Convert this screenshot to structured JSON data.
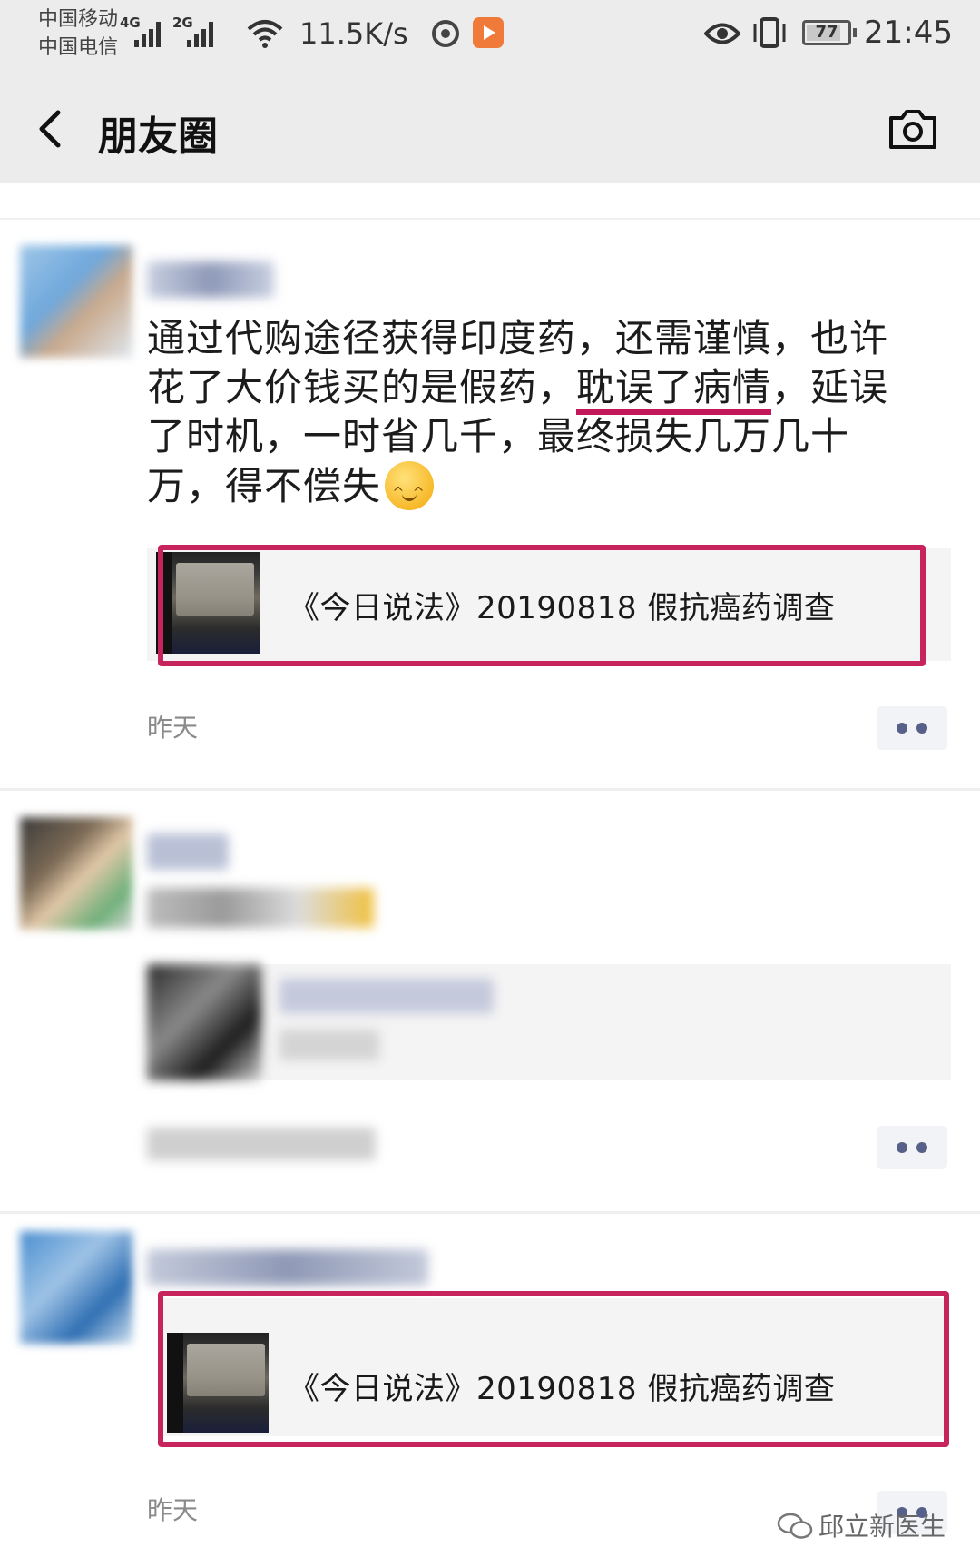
{
  "status_bar": {
    "carrier_1": "中国移动",
    "carrier_2": "中国电信",
    "network_1": "4G",
    "network_2": "2G",
    "speed": "11.5K/s",
    "battery": "77",
    "time": "21:45",
    "icons": [
      "signal-icon",
      "wifi-icon",
      "weibo-icon",
      "video-app-icon",
      "eye-icon",
      "vibrate-icon",
      "battery-icon"
    ]
  },
  "nav": {
    "title": "朋友圈",
    "back_icon": "chevron-left-icon",
    "camera_icon": "camera-icon"
  },
  "posts": [
    {
      "text_part1": "通过代购途径获得印度药，还需谨慎，也许花了大价钱买的是假药，",
      "text_underlined": "耽误了病情",
      "text_part2": "，延误了时机，一时省几千，最终损失几万几十万，得不偿失",
      "link_title": "《今日说法》20190818 假抗癌药调查",
      "time": "昨天"
    },
    {
      "time": ""
    },
    {
      "link_title": "《今日说法》20190818 假抗癌药调查",
      "time": "昨天"
    }
  ],
  "watermark": "邱立新医生",
  "colors": {
    "highlight": "#c7245e",
    "more_dots": "#566088",
    "bar_background": "#ececec"
  }
}
